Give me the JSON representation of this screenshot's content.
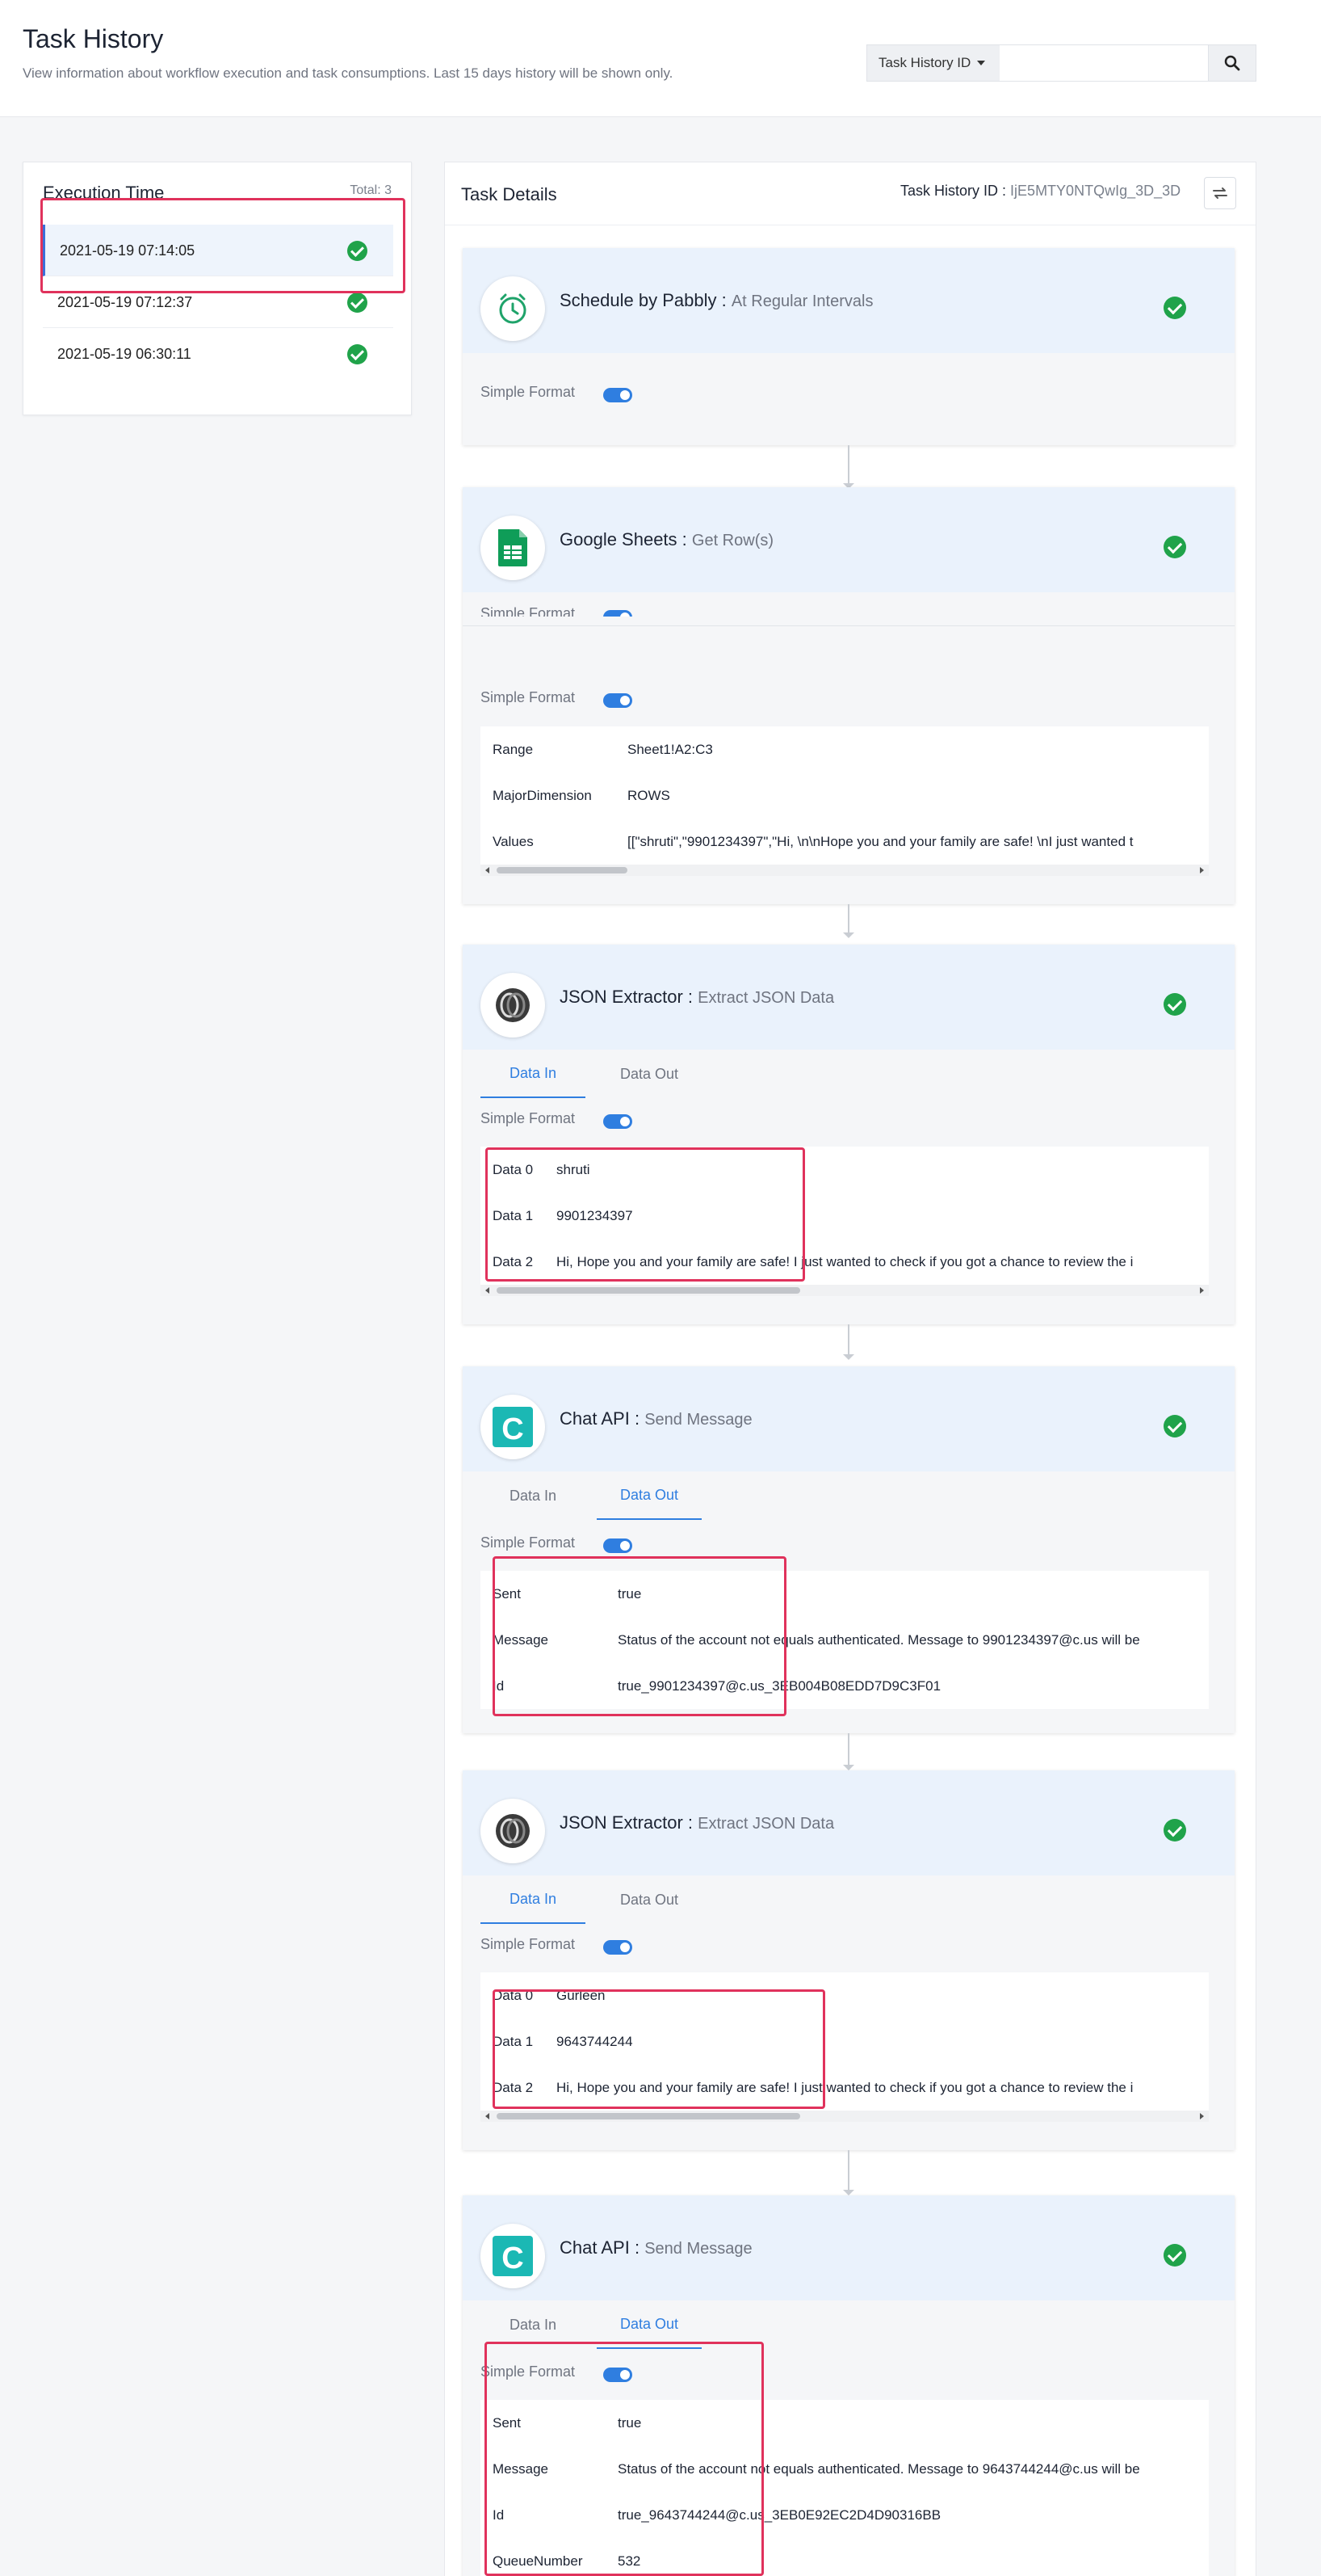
{
  "header": {
    "title": "Task History",
    "subtitle": "View information about workflow execution and task consumptions. Last 15 days history will be shown only.",
    "search": {
      "dropdown_label": "Task History ID",
      "placeholder": "",
      "icon": "search-icon"
    }
  },
  "execution": {
    "title": "Execution Time",
    "total": "Total: 3",
    "rows": [
      {
        "time": "2021-05-19 07:14:05",
        "status": "success"
      },
      {
        "time": "2021-05-19 07:12:37",
        "status": "success"
      },
      {
        "time": "2021-05-19 06:30:11",
        "status": "success"
      }
    ]
  },
  "details": {
    "title": "Task Details",
    "history_id_label": "Task History ID :",
    "history_id_value": "IjE5MTY0NTQwIg_3D_3D",
    "steps": [
      {
        "app": "Schedule by Pabbly",
        "action": "At Regular Intervals",
        "simple_format": "Simple Format"
      },
      {
        "app": "Google Sheets",
        "action": "Get Row(s)",
        "simple_format": "Simple Format",
        "rows": [
          {
            "k": "Range",
            "v": "Sheet1!A2:C3"
          },
          {
            "k": "MajorDimension",
            "v": "ROWS"
          },
          {
            "k": "Values",
            "v": "[[\"shruti\",\"9901234397\",\"Hi, \\n\\nHope you and your family are safe! \\nI just wanted t"
          }
        ]
      },
      {
        "app": "JSON Extractor",
        "action": "Extract JSON Data",
        "simple_format": "Simple Format",
        "tabs": [
          "Data In",
          "Data Out"
        ],
        "active_tab": 0,
        "rows": [
          {
            "k": "Data 0",
            "v": "shruti"
          },
          {
            "k": "Data 1",
            "v": "9901234397"
          },
          {
            "k": "Data 2",
            "v": "Hi, Hope you and your family are safe! I just wanted to check if you got a chance to review the i"
          }
        ]
      },
      {
        "app": "Chat API",
        "action": "Send Message",
        "simple_format": "Simple Format",
        "tabs": [
          "Data In",
          "Data Out"
        ],
        "active_tab": 1,
        "rows": [
          {
            "k": "Sent",
            "v": "true"
          },
          {
            "k": "Message",
            "v": "Status of the account not equals authenticated. Message to 9901234397@c.us will be"
          },
          {
            "k": "Id",
            "v": "true_9901234397@c.us_3EB004B08EDD7D9C3F01"
          }
        ]
      },
      {
        "app": "JSON Extractor",
        "action": "Extract JSON Data",
        "simple_format": "Simple Format",
        "tabs": [
          "Data In",
          "Data Out"
        ],
        "active_tab": 0,
        "rows": [
          {
            "k": "Data 0",
            "v": "Gurleen"
          },
          {
            "k": "Data 1",
            "v": "9643744244"
          },
          {
            "k": "Data 2",
            "v": "Hi, Hope you and your family are safe! I just wanted to check if you got a chance to review the i"
          }
        ]
      },
      {
        "app": "Chat API",
        "action": "Send Message",
        "simple_format": "Simple Format",
        "tabs": [
          "Data In",
          "Data Out"
        ],
        "active_tab": 1,
        "rows": [
          {
            "k": "Sent",
            "v": "true"
          },
          {
            "k": "Message",
            "v": "Status of the account not equals authenticated. Message to 9643744244@c.us will be"
          },
          {
            "k": "Id",
            "v": "true_9643744244@c.us_3EB0E92EC2D4D90316BB"
          },
          {
            "k": "QueueNumber",
            "v": "532"
          }
        ]
      }
    ]
  },
  "colors": {
    "accent": "#2f7ee0",
    "success": "#20a34a",
    "highlight": "#e0325c",
    "header_bg": "#eaf2fc"
  }
}
